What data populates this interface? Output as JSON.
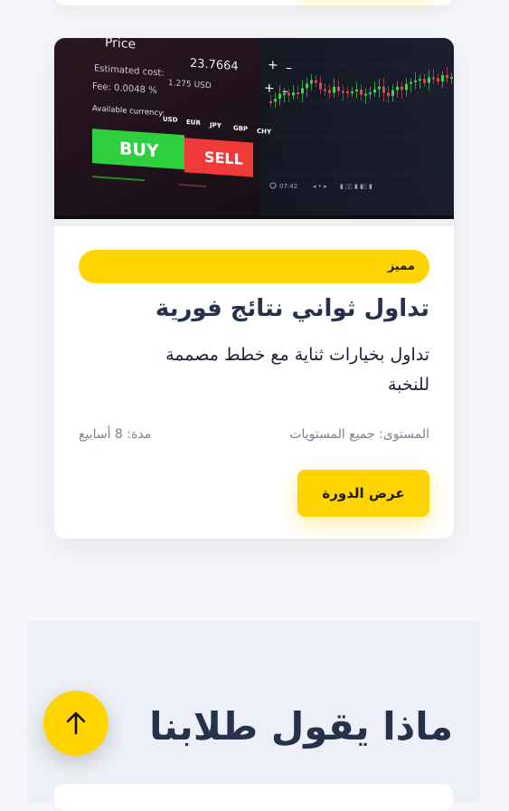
{
  "course": {
    "image_alt": "Trading platform screen",
    "badge": "مميز",
    "title": "تداول ثواني نتائج فورية",
    "description": "تداول بخيارات ثناية مع خطط مصممة للنخبة",
    "level": "المستوى: جميع المستويات",
    "duration": "مدة: 8 أسابيع",
    "button_label": "عرض الدورة",
    "screen": {
      "price_label": "Price",
      "price_value": "23.7664",
      "estimated_cost_label": "Estimated cost:",
      "estimated_cost_value": "1.275 USD",
      "fee": "Fee:  0.0048 %",
      "currencies_label": "Available currency:",
      "currencies": [
        "USD",
        "EUR",
        "JPY",
        "GBP",
        "CHY"
      ],
      "buy_label": "BUY",
      "sell_label": "SELL",
      "time": "07:42"
    }
  },
  "testimonials": {
    "title": "ماذا يقول طلابنا"
  },
  "colors": {
    "accent": "#ffd400",
    "heading": "#26324c",
    "buy": "#2fcf3f",
    "sell": "#f03a3a"
  },
  "icons": {
    "scroll_top": "arrow-up-icon"
  }
}
